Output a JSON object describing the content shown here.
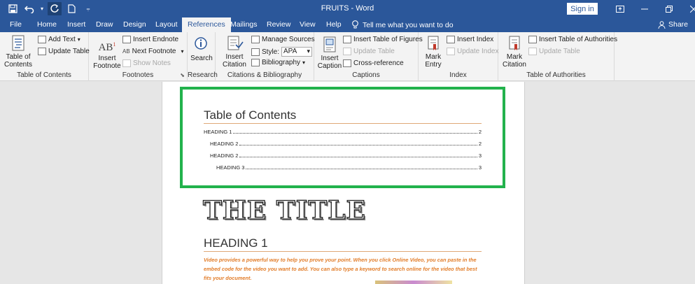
{
  "titlebar": {
    "doc_title": "FRUITS  -  Word",
    "signin_label": "Sign in",
    "qat_icons": [
      "save-icon",
      "undo-icon",
      "redo-icon",
      "new-document-icon",
      "customize-icon"
    ]
  },
  "tabs": [
    {
      "label": "File"
    },
    {
      "label": "Home"
    },
    {
      "label": "Insert"
    },
    {
      "label": "Draw"
    },
    {
      "label": "Design"
    },
    {
      "label": "Layout"
    },
    {
      "label": "References",
      "active": true
    },
    {
      "label": "Mailings"
    },
    {
      "label": "Review"
    },
    {
      "label": "View"
    },
    {
      "label": "Help"
    }
  ],
  "tell_me": "Tell me what you want to do",
  "share": "Share",
  "ribbon": {
    "toc": {
      "group_label": "Table of Contents",
      "toc_button": "Table of\nContents",
      "add_text": "Add Text",
      "update_table": "Update Table"
    },
    "footnotes": {
      "group_label": "Footnotes",
      "insert_footnote": "Insert\nFootnote",
      "insert_endnote": "Insert Endnote",
      "next_footnote": "Next Footnote",
      "show_notes": "Show Notes"
    },
    "research": {
      "group_label": "Research",
      "search": "Search"
    },
    "citations": {
      "group_label": "Citations & Bibliography",
      "insert_citation": "Insert\nCitation",
      "manage_sources": "Manage Sources",
      "style_label": "Style:",
      "style_value": "APA",
      "bibliography": "Bibliography"
    },
    "captions": {
      "group_label": "Captions",
      "insert_caption": "Insert\nCaption",
      "insert_table_of_figures": "Insert Table of Figures",
      "update_table": "Update Table",
      "cross_reference": "Cross-reference"
    },
    "index": {
      "group_label": "Index",
      "mark_entry": "Mark\nEntry",
      "insert_index": "Insert Index",
      "update_index": "Update Index"
    },
    "authorities": {
      "group_label": "Table of Authorities",
      "mark_citation": "Mark\nCitation",
      "insert_toa": "Insert Table of Authorities",
      "update_table": "Update Table"
    }
  },
  "document": {
    "toc_title": "Table of Contents",
    "toc_entries": [
      {
        "label": "HEADING 1",
        "page": "2"
      },
      {
        "label": "HEADING 2",
        "page": "2"
      },
      {
        "label": "HEADING 2",
        "page": "3"
      },
      {
        "label": "HEADING 3",
        "page": "3"
      }
    ],
    "title": "THE TITLE",
    "heading1": "HEADING 1",
    "body_text": "Video provides a powerful way to help you prove your point. When you click Online Video, you can paste in the embed code for the video you want to add. You can also type a keyword to search online for the video that best fits your document."
  },
  "colors": {
    "word_blue": "#2b579a",
    "highlight_green": "#22b24c",
    "body_orange": "#e27d2a"
  }
}
